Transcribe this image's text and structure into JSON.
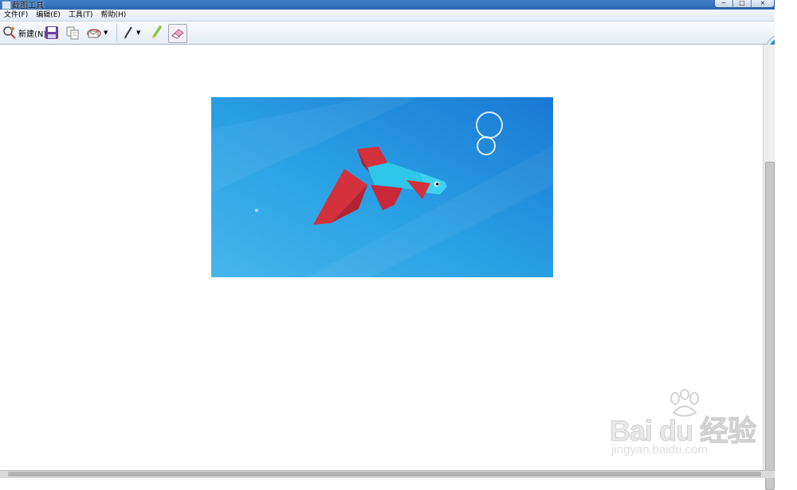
{
  "window": {
    "title": "截图工具",
    "controls": {
      "minimize": "−",
      "maximize": "□",
      "close": "×"
    }
  },
  "menu": {
    "items": [
      {
        "label": "文件(F)"
      },
      {
        "label": "编辑(E)"
      },
      {
        "label": "工具(T)"
      },
      {
        "label": "帮助(H)"
      }
    ]
  },
  "toolbar": {
    "new_label": "新建(N)",
    "icons": [
      "new-snip-icon",
      "save-icon",
      "copy-icon",
      "send-snip-icon",
      "pen-icon",
      "highlighter-icon",
      "eraser-icon"
    ]
  },
  "watermark": {
    "brand": "Bai du 经验",
    "url": "jingyan.baidu.com"
  },
  "colors": {
    "titlebar": "#2b66b0",
    "image_bg_start": "#1b78d4",
    "image_bg_end": "#47b6ec",
    "fish_body": "#2fc6ea",
    "fish_fins": "#d3313b"
  }
}
